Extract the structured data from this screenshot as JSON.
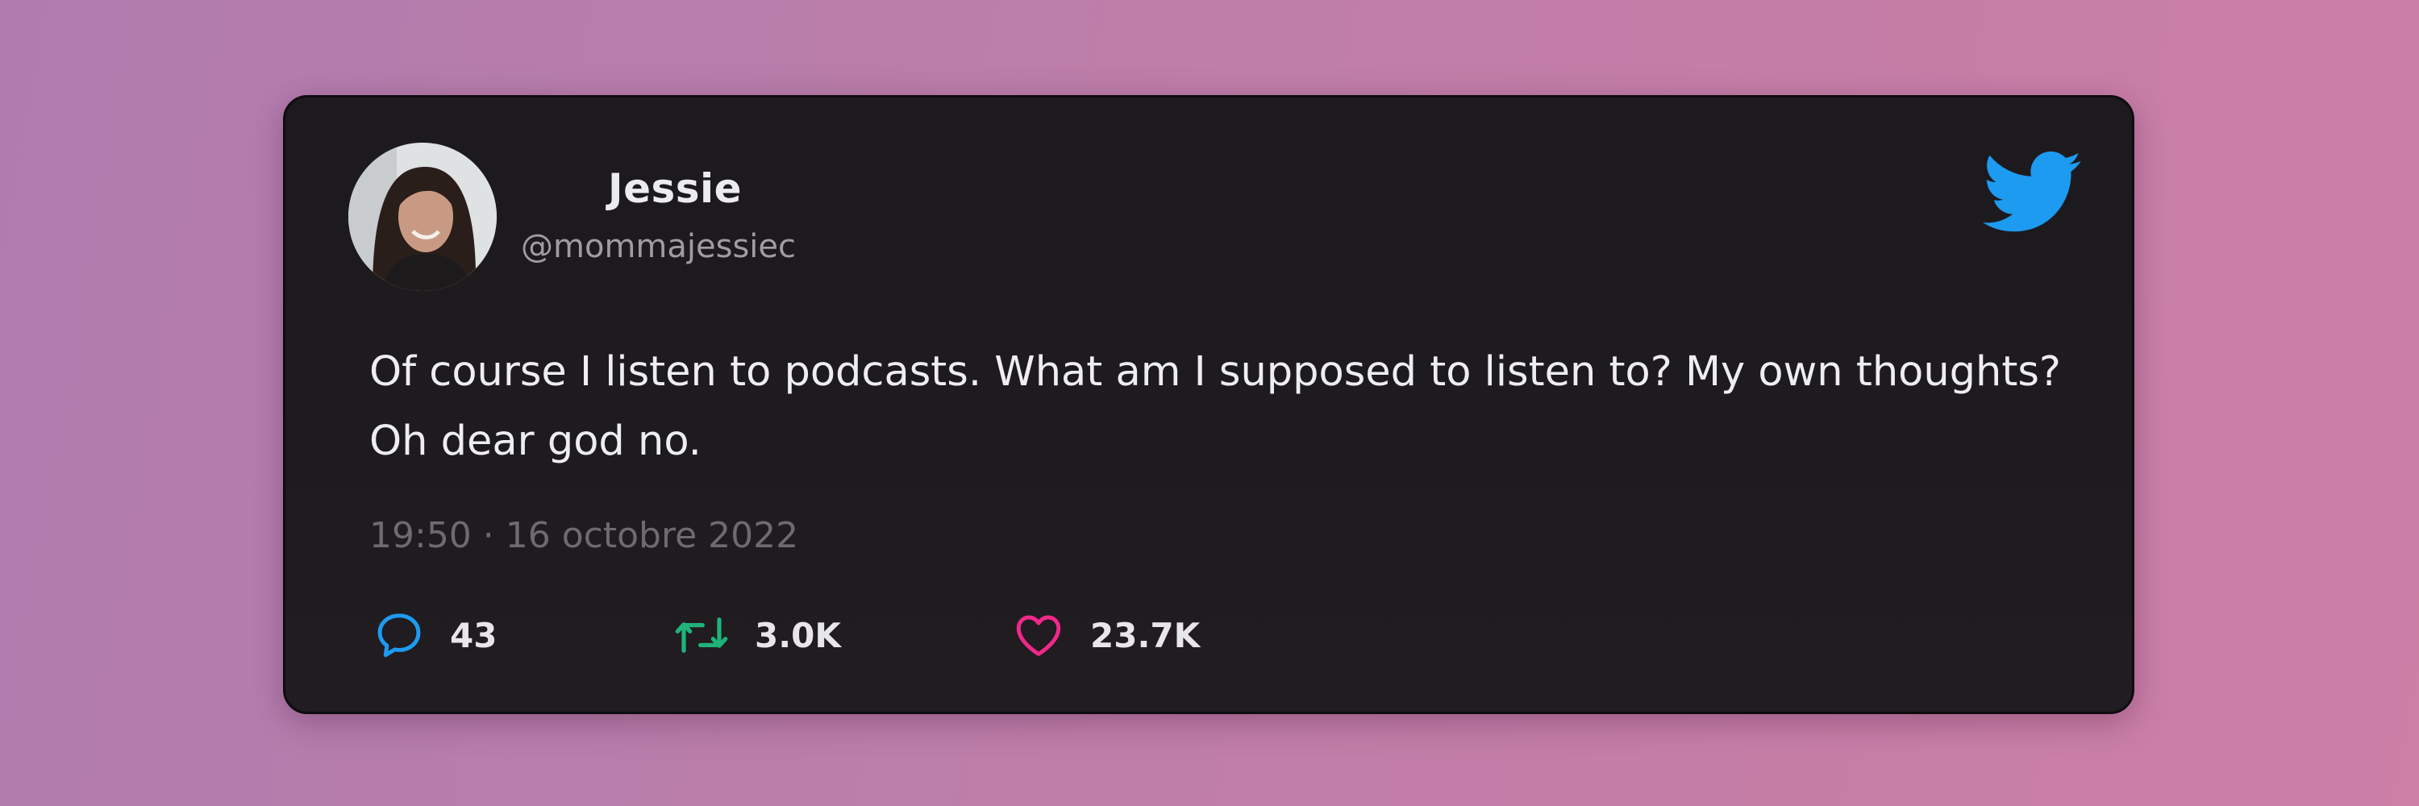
{
  "tweet": {
    "author": {
      "display_name": "Jessie",
      "handle": "@mommajessiec",
      "avatar_icon": "profile-photo"
    },
    "brand_icon": "twitter-bird-icon",
    "brand_color": "#1d9bf0",
    "text": "Of course I listen to podcasts. What am I supposed to listen to? My own thoughts? Oh dear god no.",
    "timestamp": "19:50 · 16 octobre 2022",
    "stats": {
      "replies": {
        "icon": "reply-bubble-icon",
        "count": "43",
        "color": "#1d9bf0"
      },
      "retweets": {
        "icon": "retweet-icon",
        "count": "3.0K",
        "color": "#1fb37a"
      },
      "likes": {
        "icon": "heart-icon",
        "count": "23.7K",
        "color": "#f0288a"
      }
    }
  },
  "colors": {
    "background_start": "#b07cae",
    "background_end": "#cd7fa6",
    "card_background": "#1e1b1f",
    "text_primary": "#eeedf0",
    "text_secondary": "#9f9ca3",
    "timestamp": "#6d6a71"
  }
}
